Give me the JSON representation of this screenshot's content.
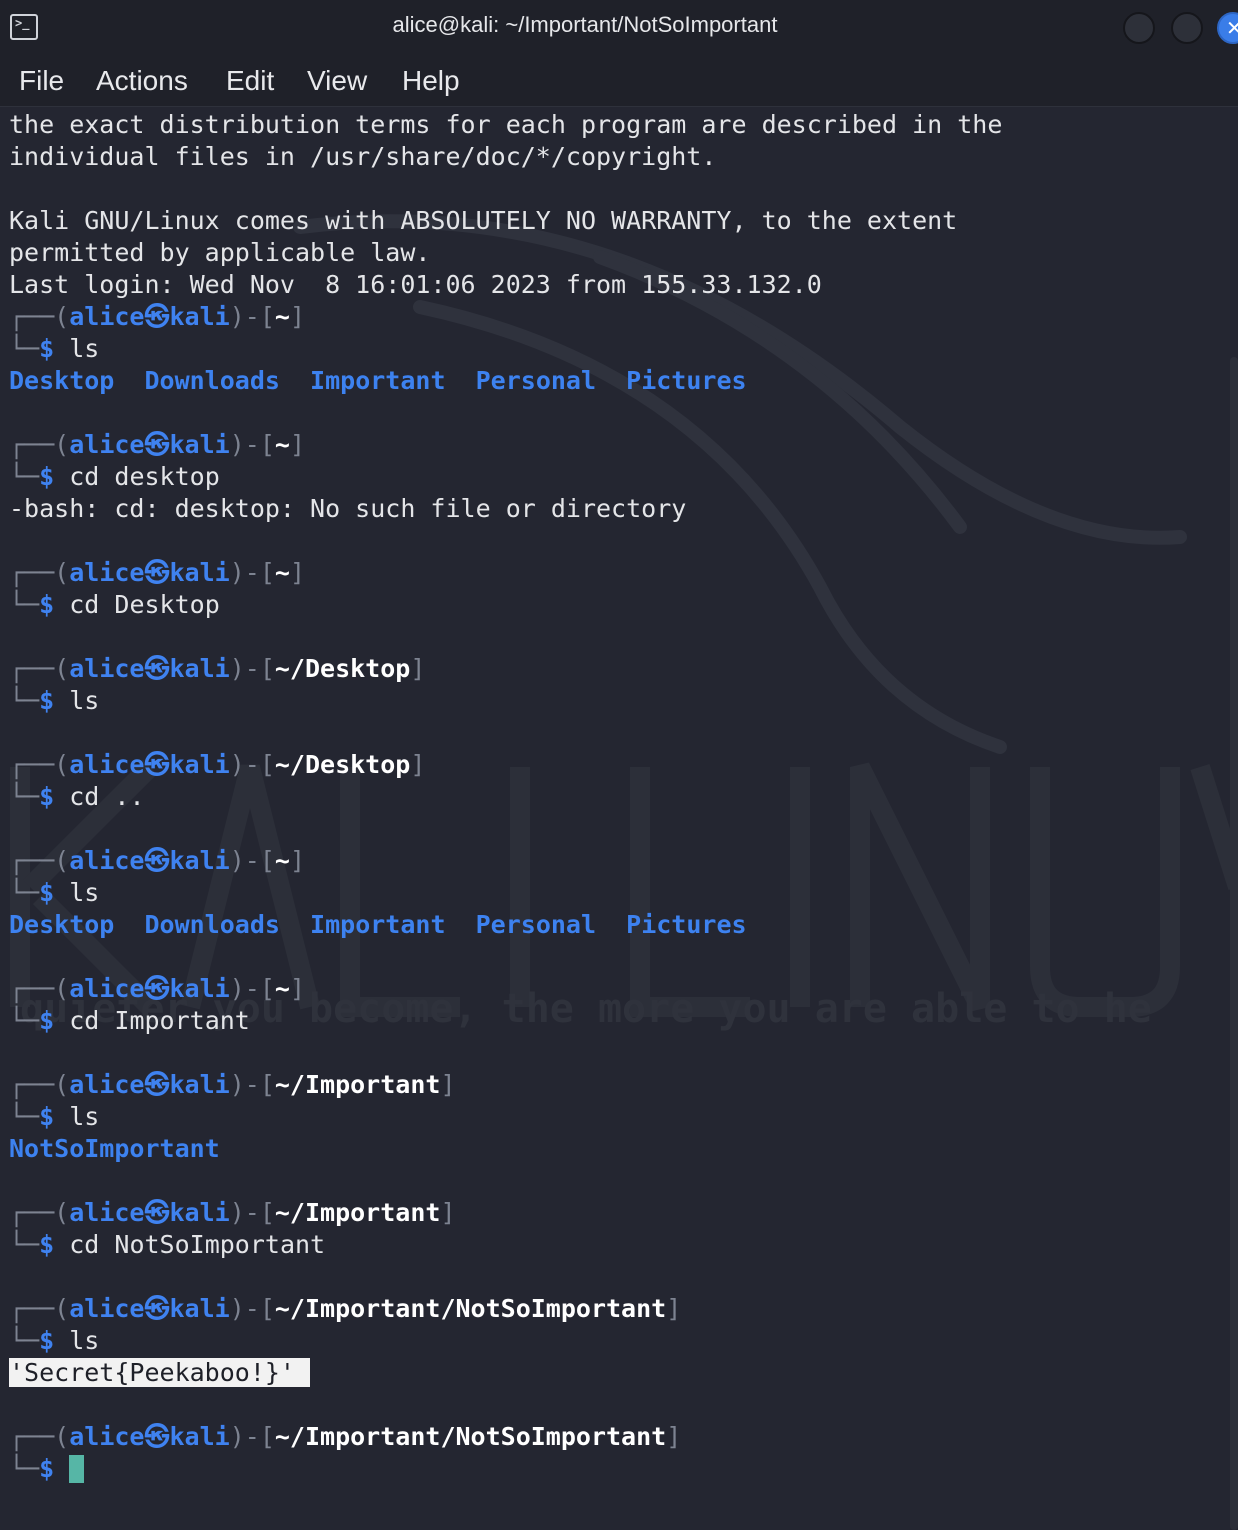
{
  "window": {
    "title": "alice@kali: ~/Important/NotSoImportant",
    "icon": "terminal-icon",
    "close_glyph": "✕"
  },
  "menu": [
    "File",
    "Actions",
    "Edit",
    "View",
    "Help"
  ],
  "watermark": {
    "logo_text": "KALI LINUX",
    "tagline": "quieter you become, the more you are able to he"
  },
  "prompt": {
    "user": "alice",
    "at_glyph": "㉿",
    "host": "kali",
    "symbol": "$"
  },
  "motd": [
    "the exact distribution terms for each program are described in the",
    "individual files in /usr/share/doc/*/copyright.",
    "",
    "Kali GNU/Linux comes with ABSOLUTELY NO WARRANTY, to the extent",
    "permitted by applicable law.",
    "Last login: Wed Nov  8 16:01:06 2023 from 155.33.132.0"
  ],
  "session": [
    {
      "cwd": "~",
      "command": "ls",
      "output": {
        "type": "dirs",
        "items": [
          "Desktop",
          "Downloads",
          "Important",
          "Personal",
          "Pictures"
        ]
      }
    },
    {
      "cwd": "~",
      "command": "cd desktop",
      "output": {
        "type": "text",
        "text": "-bash: cd: desktop: No such file or directory"
      }
    },
    {
      "cwd": "~",
      "command": "cd Desktop"
    },
    {
      "cwd": "~/Desktop",
      "command": "ls"
    },
    {
      "cwd": "~/Desktop",
      "command": "cd .."
    },
    {
      "cwd": "~",
      "command": "ls",
      "output": {
        "type": "dirs",
        "items": [
          "Desktop",
          "Downloads",
          "Important",
          "Personal",
          "Pictures"
        ]
      }
    },
    {
      "cwd": "~",
      "command": "cd Important"
    },
    {
      "cwd": "~/Important",
      "command": "ls",
      "output": {
        "type": "dirs",
        "items": [
          "NotSoImportant"
        ]
      }
    },
    {
      "cwd": "~/Important",
      "command": "cd NotSoImportant"
    },
    {
      "cwd": "~/Important/NotSoImportant",
      "command": "ls",
      "output": {
        "type": "selected",
        "text": "'Secret{Peekaboo!}'"
      }
    },
    {
      "cwd": "~/Important/NotSoImportant",
      "command": "",
      "cursor": true
    }
  ],
  "colors": {
    "background": "#242631",
    "prompt_blue": "#3f82f0",
    "cursor": "#56b6a6"
  }
}
